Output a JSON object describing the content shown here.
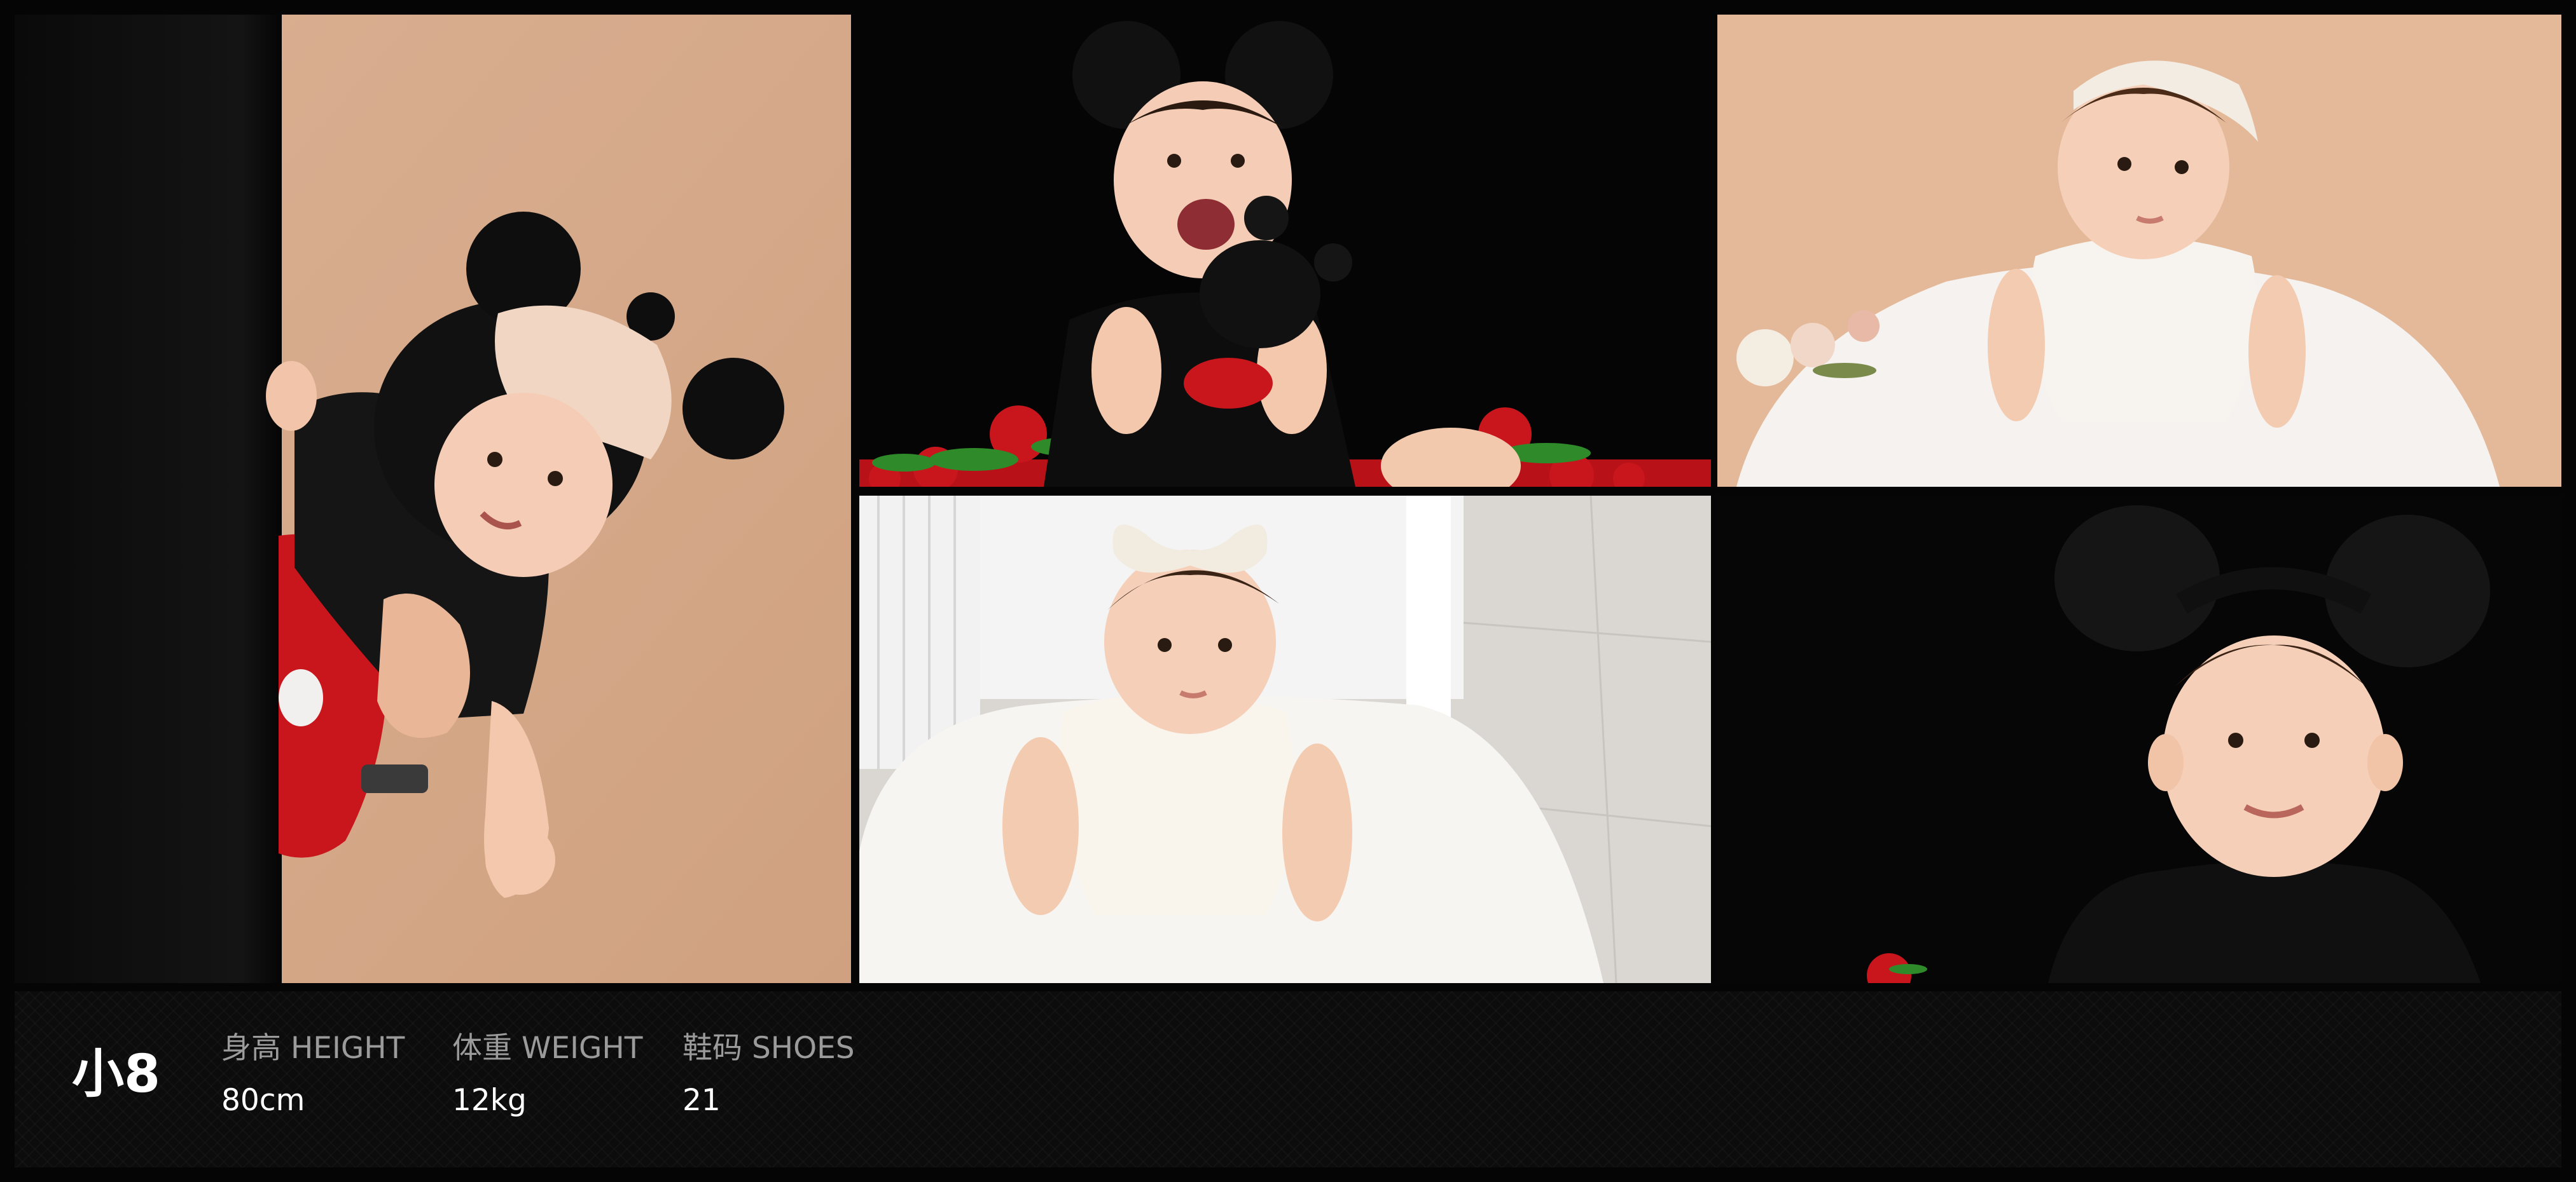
{
  "photos": [
    {
      "subject": "baby in mickey mouse hood peeking from black curtain",
      "background": "#d8ac8c"
    },
    {
      "subject": "laughing baby with mickey ears holding toy, red roses",
      "background": "#050505"
    },
    {
      "subject": "baby in white lace dress with headband, flowers",
      "background": "#e4b999"
    },
    {
      "subject": "baby in white dress with lace bow sitting on floor",
      "background": "#dcd8d4"
    },
    {
      "subject": "smiling baby with mickey mouse ears headband",
      "background": "#060606"
    }
  ],
  "profile": {
    "name": "小8",
    "height_label": "身高 HEIGHT",
    "height_value": "80cm",
    "weight_label": "体重 WEIGHT",
    "weight_value": "12kg",
    "shoes_label": "鞋码 SHOES",
    "shoes_value": "21"
  },
  "colors": {
    "page_background": "#050505",
    "info_bar": "#0c0c0c",
    "label_text": "#9b9b9b",
    "value_text": "#ffffff",
    "beige_backdrop": "#d8ac8c",
    "rose_red": "#c8161c"
  }
}
